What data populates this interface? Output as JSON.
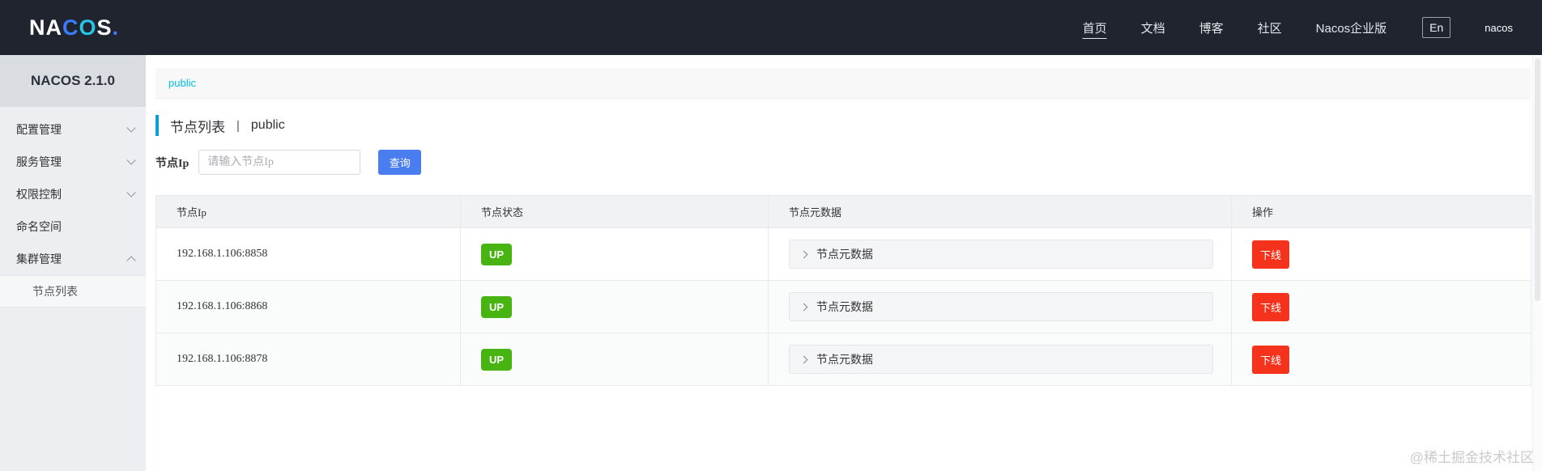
{
  "header": {
    "logo": {
      "part_white1": "NA",
      "part_blue": "C",
      "part_cyan": "O",
      "part_white2": "S",
      "part_dot": "."
    },
    "nav": [
      {
        "label": "首页",
        "active": true
      },
      {
        "label": "文档",
        "active": false
      },
      {
        "label": "博客",
        "active": false
      },
      {
        "label": "社区",
        "active": false
      },
      {
        "label": "Nacos企业版",
        "active": false
      }
    ],
    "lang_button": "En",
    "username": "nacos"
  },
  "sidebar": {
    "version": "NACOS 2.1.0",
    "items": [
      {
        "label": "配置管理",
        "chevron": "down"
      },
      {
        "label": "服务管理",
        "chevron": "down"
      },
      {
        "label": "权限控制",
        "chevron": "down"
      },
      {
        "label": "命名空间",
        "chevron": "none"
      },
      {
        "label": "集群管理",
        "chevron": "up"
      }
    ],
    "subitem": {
      "label": "节点列表",
      "active": true
    }
  },
  "main": {
    "namespace_tab": "public",
    "page_title": {
      "name": "节点列表",
      "separator": "|",
      "namespace": "public"
    },
    "search": {
      "label": "节点Ip",
      "placeholder": "请输入节点Ip",
      "button": "查询"
    },
    "table": {
      "headers": [
        "节点Ip",
        "节点状态",
        "节点元数据",
        "操作"
      ],
      "rows": [
        {
          "ip": "192.168.1.106:8858",
          "status": "UP",
          "metadata_label": "节点元数据",
          "action": "下线"
        },
        {
          "ip": "192.168.1.106:8868",
          "status": "UP",
          "metadata_label": "节点元数据",
          "action": "下线"
        },
        {
          "ip": "192.168.1.106:8878",
          "status": "UP",
          "metadata_label": "节点元数据",
          "action": "下线"
        }
      ]
    }
  },
  "watermark": "@稀土掘金技术社区",
  "colors": {
    "header_bg": "#1f242e",
    "logo_blue": "#3a7dff",
    "logo_cyan": "#26c5e8",
    "namespace_text": "#00c1de",
    "title_accent": "#0a9dd6",
    "primary_button": "#4a7df0",
    "status_up_green": "#48b412",
    "offline_red": "#f5331c",
    "sidebar_bg": "#edeef1",
    "version_box_bg": "#d9dce1",
    "table_header_bg": "#f0f2f4"
  }
}
